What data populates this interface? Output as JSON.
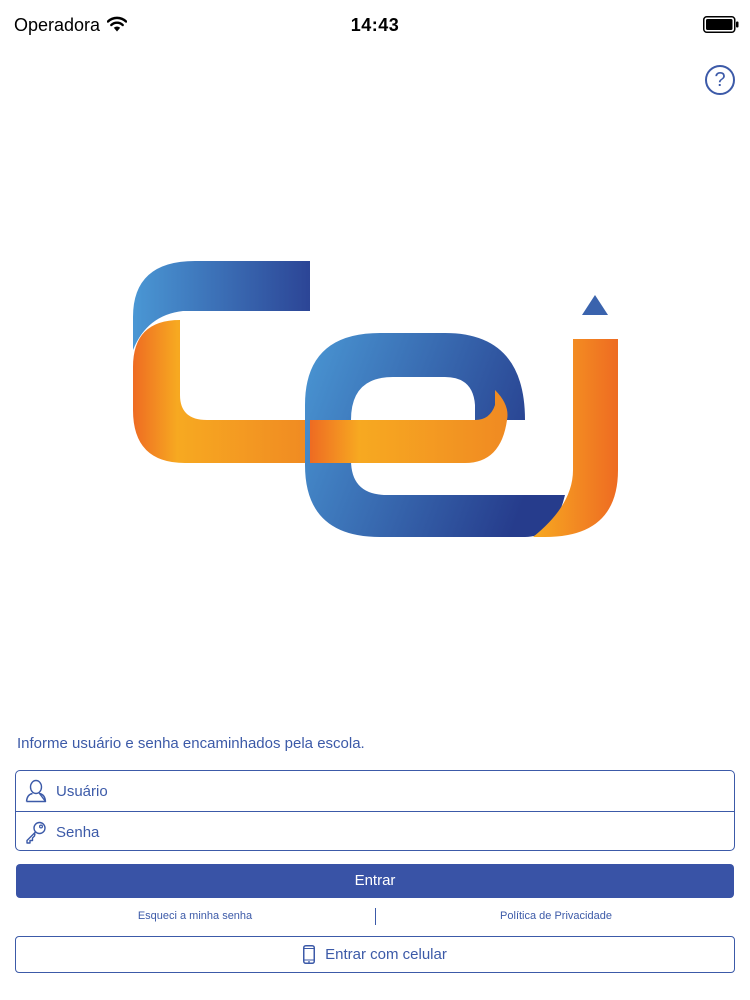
{
  "status_bar": {
    "carrier": "Operadora",
    "time": "14:43",
    "icons": [
      "wifi-icon",
      "battery-icon"
    ]
  },
  "header": {
    "help_label": "?",
    "help_icon": "question-circle-icon"
  },
  "logo": {
    "colors": {
      "blue_light": "#4a97d4",
      "blue_dark": "#283f8f",
      "orange_light": "#f7a921",
      "orange_dark": "#ee6b22"
    }
  },
  "login": {
    "instructions": "Informe usuário e senha encaminhados pela escola.",
    "username": {
      "placeholder": "Usuário",
      "value": "",
      "icon": "user-icon"
    },
    "password": {
      "placeholder": "Senha",
      "value": "",
      "icon": "key-icon"
    },
    "submit_label": "Entrar",
    "forgot_label": "Esqueci a minha senha",
    "privacy_label": "Política de Privacidade",
    "phone_login_label": "Entrar com celular",
    "phone_icon": "mobile-phone-icon"
  },
  "colors": {
    "primary": "#3953a6",
    "text_accent": "#3c5aa8",
    "background": "#ffffff"
  }
}
